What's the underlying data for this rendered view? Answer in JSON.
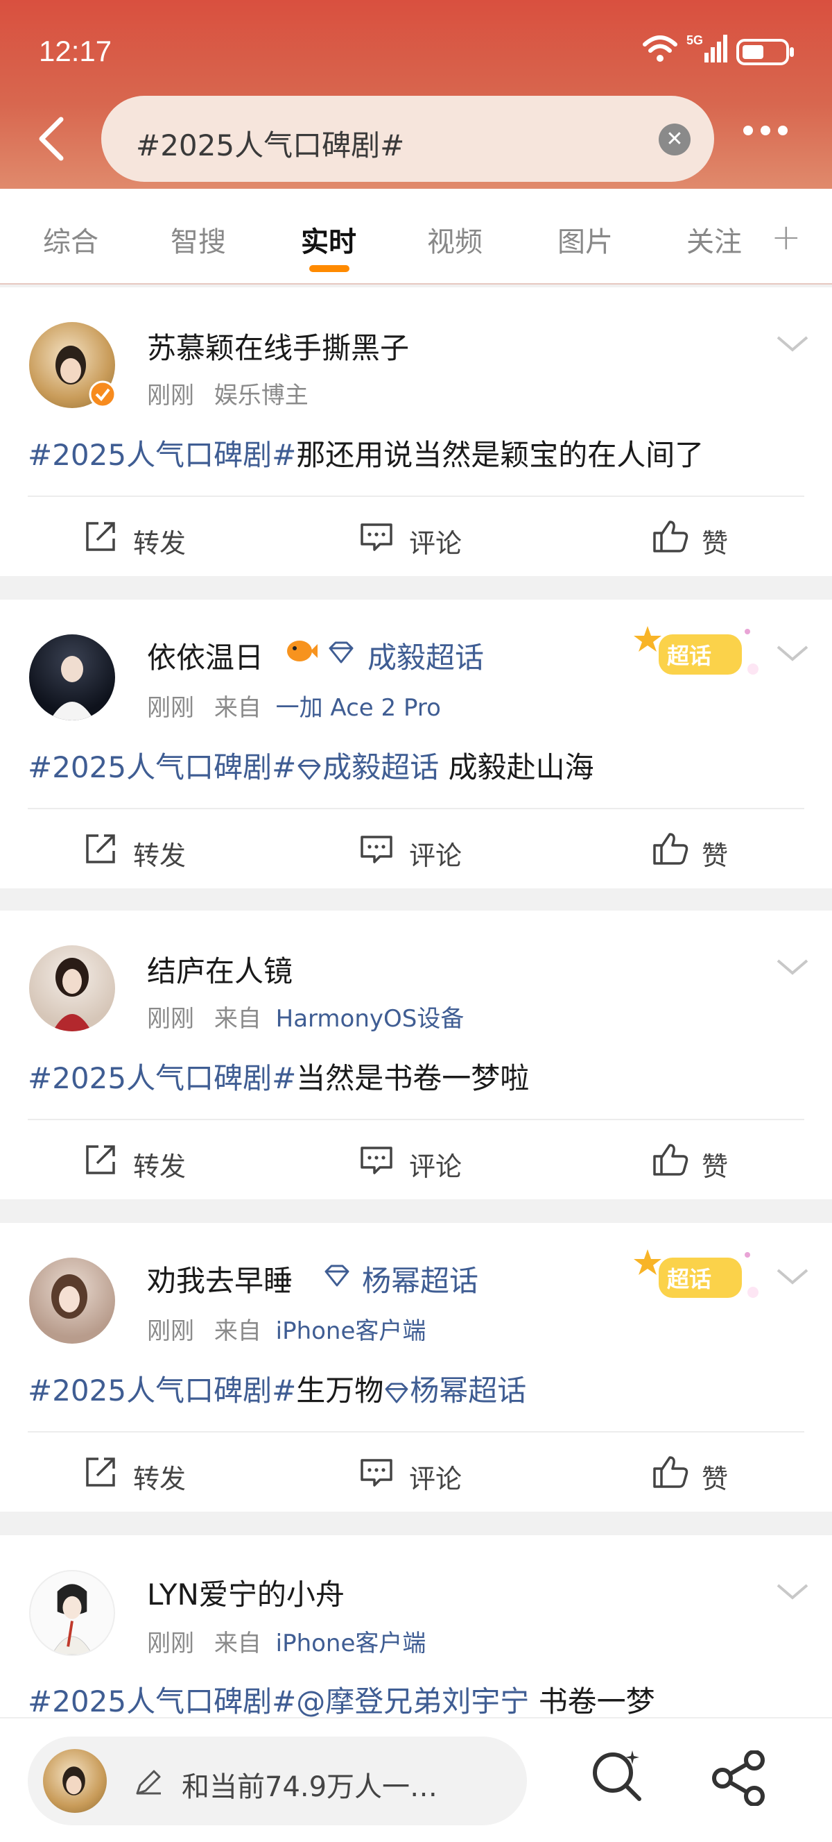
{
  "status_bar": {
    "time": "12:17",
    "network": "5G"
  },
  "search": {
    "query": "#2025人气口碑剧#"
  },
  "tabs": [
    {
      "label": "综合"
    },
    {
      "label": "智搜"
    },
    {
      "label": "实时",
      "active": true
    },
    {
      "label": "视频"
    },
    {
      "label": "图片"
    },
    {
      "label": "关注"
    }
  ],
  "actions": {
    "repost": "转发",
    "comment": "评论",
    "like": "赞"
  },
  "posts": [
    {
      "user": "苏慕颖在线手撕黑子",
      "time": "刚刚",
      "source": "娱乐博主",
      "hashtag": "#2025人气口碑剧#",
      "text": "那还用说当然是颖宝的在人间了"
    },
    {
      "user": "依依温日",
      "user_super": "成毅超话",
      "time": "刚刚",
      "from": "来自",
      "source": "一加 Ace 2 Pro",
      "hashtag": "#2025人气口碑剧#",
      "super_topic": "成毅超话",
      "text": "成毅赴山海",
      "badge": "超话"
    },
    {
      "user": "结庐在人镜",
      "time": "刚刚",
      "from": "来自",
      "source": "HarmonyOS设备",
      "hashtag": "#2025人气口碑剧#",
      "text": "当然是书卷一梦啦"
    },
    {
      "user": "劝我去早睡",
      "user_super": "杨幂超话",
      "time": "刚刚",
      "from": "来自",
      "source": "iPhone客户端",
      "hashtag": "#2025人气口碑剧#",
      "text": "生万物",
      "super_topic": "杨幂超话",
      "badge": "超话"
    },
    {
      "user": "LYN爱宁的小舟",
      "time": "刚刚",
      "from": "来自",
      "source": "iPhone客户端",
      "hashtag": "#2025人气口碑剧#",
      "mention": "@摩登兄弟刘宇宁",
      "text": "书卷一梦"
    }
  ],
  "composer": {
    "placeholder": "和当前74.9万人一…"
  },
  "colors": {
    "brand_red": "#d9503f",
    "link_blue": "#3f5d93",
    "accent_orange": "#ff8a00"
  }
}
